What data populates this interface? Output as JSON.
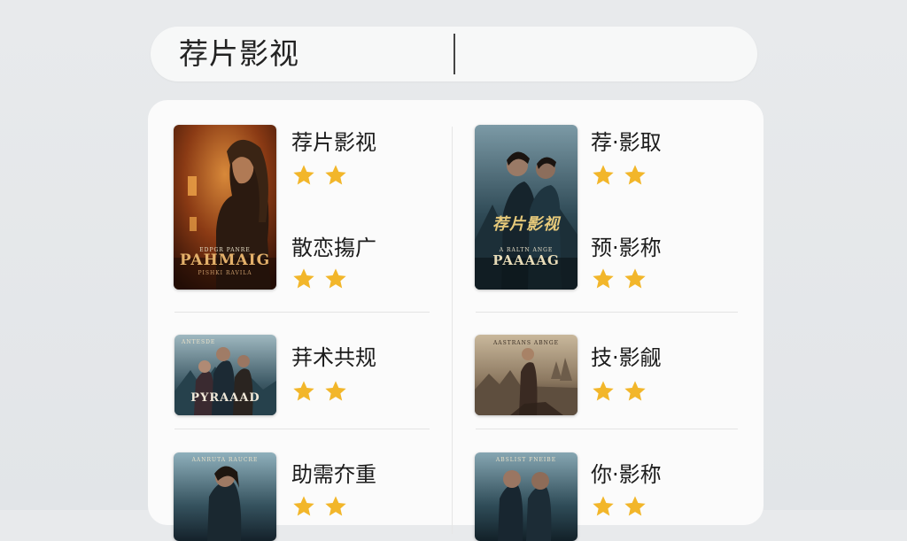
{
  "search": {
    "query": "荐片影视"
  },
  "results": [
    {
      "poster_title": "PAHMAIG",
      "poster_top": "EDPGR PANRE",
      "poster_sub": "PISHKI RAVILA",
      "items": [
        {
          "title": "荐片影视",
          "stars": 2
        },
        {
          "title": "散恋摥广",
          "stars": 2
        }
      ]
    },
    {
      "poster_title": "PAAAAG",
      "poster_top": "A RALTN ANGE",
      "poster_overlay": "荐片影视",
      "items": [
        {
          "title": "荐·影取",
          "stars": 2
        },
        {
          "title": "预·影称",
          "stars": 2
        }
      ]
    },
    {
      "poster_title": "PYRAAAD",
      "poster_top": "ANTESDE",
      "items": [
        {
          "title": "荓术共规",
          "stars": 2
        }
      ]
    },
    {
      "poster_title": "",
      "poster_top": "AASTRANS ABNGE",
      "items": [
        {
          "title": "技·影觎",
          "stars": 2
        }
      ]
    },
    {
      "poster_title": "",
      "poster_top": "AANRUTA RAUCRE",
      "items": [
        {
          "title": "助需夰重",
          "stars": 2
        }
      ]
    },
    {
      "poster_title": "",
      "poster_top": "ABSLIST FNEIBE",
      "items": [
        {
          "title": "你·影称",
          "stars": 2
        }
      ]
    }
  ],
  "colors": {
    "star": "#f2b62a",
    "accent_gold": "#d9a85a"
  },
  "icons": {
    "star": "star-icon"
  }
}
